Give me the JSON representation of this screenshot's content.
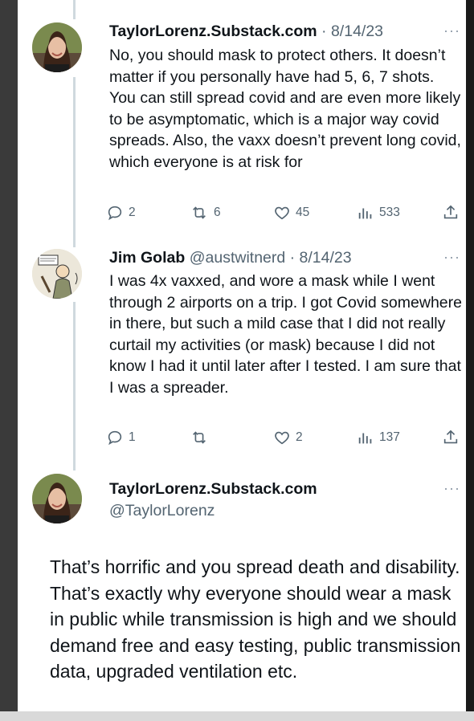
{
  "tweets": [
    {
      "author": "TaylorLorenz.Substack.com",
      "meta": "· 8/14/23",
      "text": "No, you should mask to protect others. It doesn’t matter if you personally have had 5, 6, 7 shots. You can still spread covid and are even more likely to be asymptomatic, which is a major way covid spreads. Also, the vaxx doesn’t prevent long covid, which everyone is at risk for",
      "replies": "2",
      "reposts": "6",
      "likes": "45",
      "views": "533"
    },
    {
      "author": "Jim Golab",
      "meta": "@austwitnerd · 8/14/23",
      "text": "I was 4x vaxxed, and wore a mask while I went through 2 airports on a trip. I got Covid somewhere in there, but such a mild case that I did not really curtail my activities (or mask) because I did not know I had it until later after I tested. I am sure that I was a spreader.",
      "replies": "1",
      "reposts": "",
      "likes": "2",
      "views": "137"
    }
  ],
  "main_tweet": {
    "author": "TaylorLorenz.Substack.com",
    "handle": "@TaylorLorenz",
    "text": "That’s horrific and you spread death and disability. That’s exactly why everyone should wear a mask in public while transmission is high and we should demand free and easy testing, public transmission data, upgraded ventilation etc."
  },
  "more_icon_label": "···",
  "icons": [
    "reply-icon",
    "repost-icon",
    "like-icon",
    "views-icon",
    "share-icon",
    "more-icon",
    "avatar"
  ],
  "colors": {
    "text": "#0f1419",
    "muted": "#536471",
    "thread_line": "#cfd9de",
    "background": "#ffffff"
  }
}
